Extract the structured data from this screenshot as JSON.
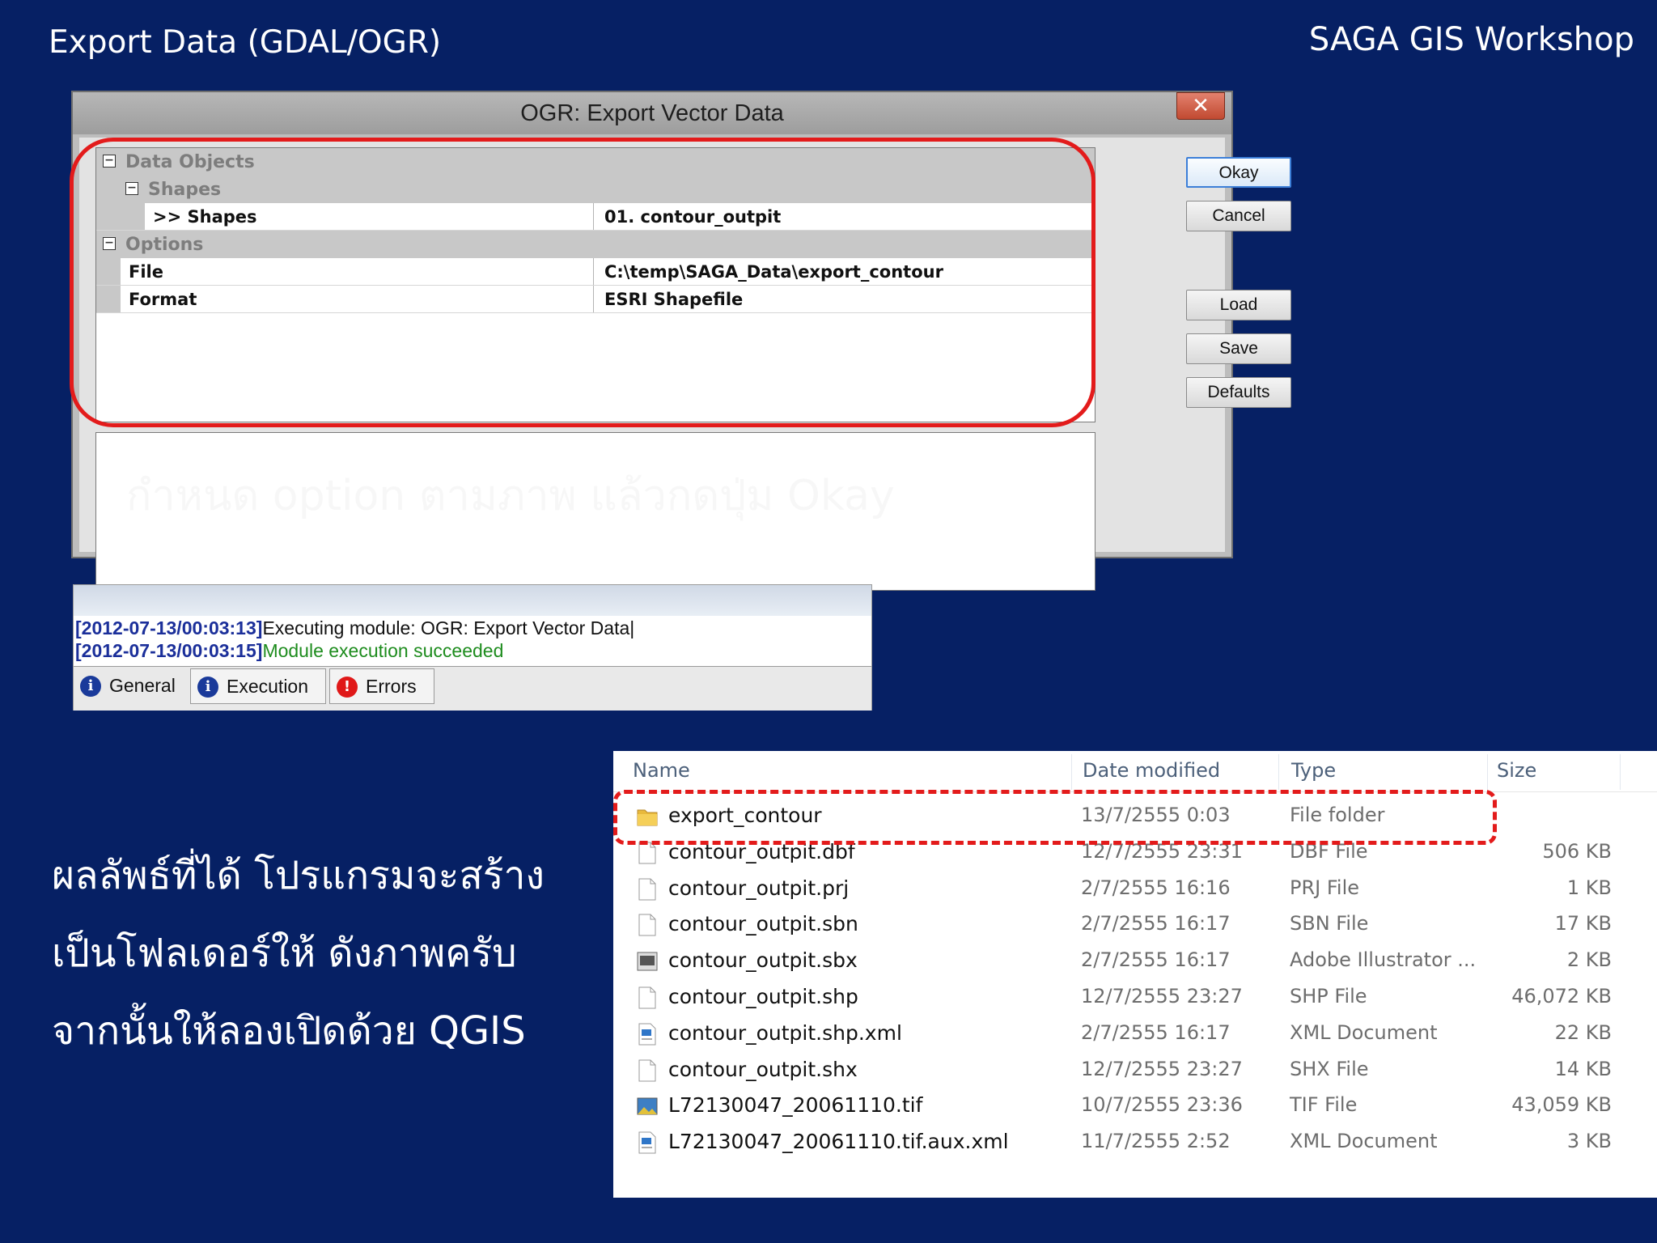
{
  "slide": {
    "title": "Export Data (GDAL/OGR)",
    "brand": "SAGA GIS Workshop"
  },
  "dialog": {
    "title": "OGR: Export Vector Data",
    "close_label": "✕",
    "tree": {
      "data_objects": "Data Objects",
      "shapes_group": "Shapes",
      "shapes_name": ">> Shapes",
      "shapes_value": "01. contour_outpit",
      "options": "Options",
      "file_name": "File",
      "file_value": "C:\\temp\\SAGA_Data\\export_contour",
      "format_name": "Format",
      "format_value": "ESRI Shapefile"
    },
    "buttons": {
      "okay": "Okay",
      "cancel": "Cancel",
      "load": "Load",
      "save": "Save",
      "defaults": "Defaults"
    },
    "overlay_instruction": "กำหนด option ตามภาพ แล้วกดปุ่ม Okay"
  },
  "log": {
    "lines": [
      {
        "ts": "[2012-07-13/00:03:13]",
        "msg": "Executing module: OGR: Export Vector Data"
      },
      {
        "ts": "[2012-07-13/00:03:15]",
        "msg": "Module execution succeeded"
      }
    ],
    "tabs": [
      {
        "label": "General",
        "icon": "info-icon"
      },
      {
        "label": "Execution",
        "icon": "info-run-icon"
      },
      {
        "label": "Errors",
        "icon": "error-icon"
      }
    ]
  },
  "caption": {
    "line1": "ผลลัพธ์ที่ได้ โปรแกรมจะสร้าง",
    "line2": "เป็นโฟลเดอร์ให้ ดังภาพครับ",
    "line3": "จากนั้นให้ลองเปิดด้วย QGIS"
  },
  "explorer": {
    "columns": {
      "name": "Name",
      "date": "Date modified",
      "type": "Type",
      "size": "Size"
    },
    "files": [
      {
        "name": "export_contour",
        "date": "13/7/2555 0:03",
        "type": "File folder",
        "size": "",
        "icon": "folder-icon"
      },
      {
        "name": "contour_outpit.dbf",
        "date": "12/7/2555 23:31",
        "type": "DBF File",
        "size": "506 KB",
        "icon": "file-icon"
      },
      {
        "name": "contour_outpit.prj",
        "date": "2/7/2555 16:16",
        "type": "PRJ File",
        "size": "1 KB",
        "icon": "file-icon"
      },
      {
        "name": "contour_outpit.sbn",
        "date": "2/7/2555 16:17",
        "type": "SBN File",
        "size": "17 KB",
        "icon": "file-icon"
      },
      {
        "name": "contour_outpit.sbx",
        "date": "2/7/2555 16:17",
        "type": "Adobe Illustrator ...",
        "size": "2 KB",
        "icon": "illustrator-file-icon"
      },
      {
        "name": "contour_outpit.shp",
        "date": "12/7/2555 23:27",
        "type": "SHP File",
        "size": "46,072 KB",
        "icon": "file-icon"
      },
      {
        "name": "contour_outpit.shp.xml",
        "date": "2/7/2555 16:17",
        "type": "XML Document",
        "size": "22 KB",
        "icon": "xml-file-icon"
      },
      {
        "name": "contour_outpit.shx",
        "date": "12/7/2555 23:27",
        "type": "SHX File",
        "size": "14 KB",
        "icon": "file-icon"
      },
      {
        "name": "L72130047_20061110.tif",
        "date": "10/7/2555 23:36",
        "type": "TIF File",
        "size": "43,059 KB",
        "icon": "image-file-icon"
      },
      {
        "name": "L72130047_20061110.tif.aux.xml",
        "date": "11/7/2555 2:52",
        "type": "XML Document",
        "size": "3 KB",
        "icon": "xml-file-icon"
      }
    ]
  },
  "colors": {
    "background": "#062064",
    "highlight": "#e31b1b",
    "timestamp": "#1b2f9a",
    "success": "#1d8c1d"
  }
}
